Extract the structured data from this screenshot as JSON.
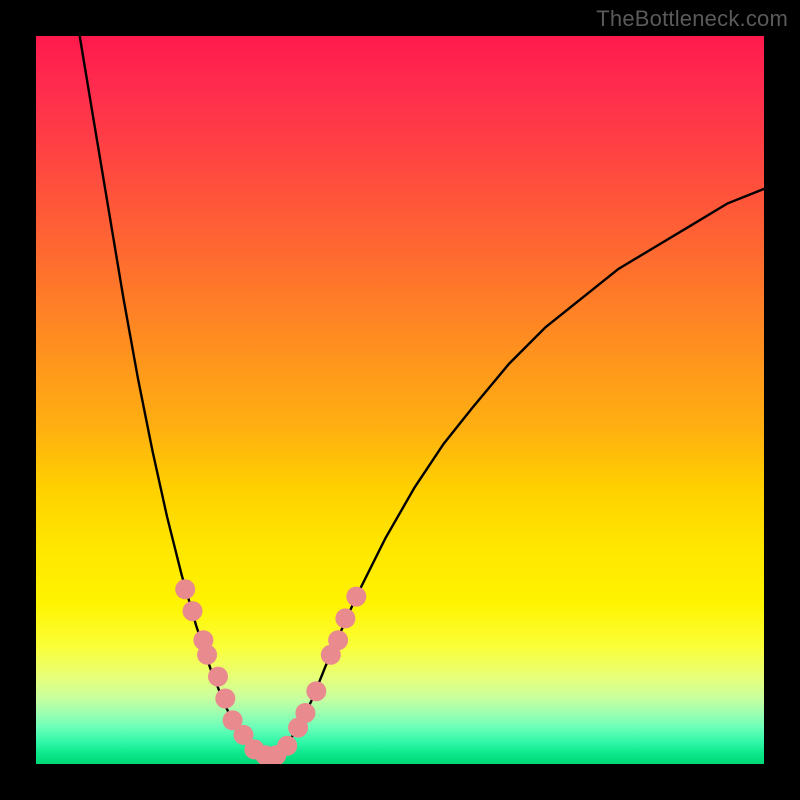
{
  "watermark": {
    "text": "TheBottleneck.com"
  },
  "colors": {
    "frame": "#000000",
    "curve": "#000000",
    "marker_fill": "#e98a8f",
    "marker_stroke": "#d06a70"
  },
  "chart_data": {
    "type": "line",
    "title": "",
    "xlabel": "",
    "ylabel": "",
    "xlim": [
      0,
      100
    ],
    "ylim": [
      0,
      100
    ],
    "curves": {
      "left": [
        {
          "x": 6,
          "y": 100
        },
        {
          "x": 8,
          "y": 88
        },
        {
          "x": 10,
          "y": 76
        },
        {
          "x": 12,
          "y": 64
        },
        {
          "x": 14,
          "y": 53
        },
        {
          "x": 16,
          "y": 43
        },
        {
          "x": 18,
          "y": 34
        },
        {
          "x": 20,
          "y": 26
        },
        {
          "x": 22,
          "y": 19
        },
        {
          "x": 24,
          "y": 13
        },
        {
          "x": 26,
          "y": 8
        },
        {
          "x": 28,
          "y": 4
        },
        {
          "x": 30,
          "y": 2
        },
        {
          "x": 32,
          "y": 1
        }
      ],
      "right": [
        {
          "x": 32,
          "y": 1
        },
        {
          "x": 34,
          "y": 2
        },
        {
          "x": 36,
          "y": 5
        },
        {
          "x": 38,
          "y": 9
        },
        {
          "x": 40,
          "y": 14
        },
        {
          "x": 44,
          "y": 23
        },
        {
          "x": 48,
          "y": 31
        },
        {
          "x": 52,
          "y": 38
        },
        {
          "x": 56,
          "y": 44
        },
        {
          "x": 60,
          "y": 49
        },
        {
          "x": 65,
          "y": 55
        },
        {
          "x": 70,
          "y": 60
        },
        {
          "x": 75,
          "y": 64
        },
        {
          "x": 80,
          "y": 68
        },
        {
          "x": 85,
          "y": 71
        },
        {
          "x": 90,
          "y": 74
        },
        {
          "x": 95,
          "y": 77
        },
        {
          "x": 100,
          "y": 79
        }
      ]
    },
    "markers": {
      "left": [
        {
          "x": 20.5,
          "y": 24
        },
        {
          "x": 21.5,
          "y": 21
        },
        {
          "x": 23.0,
          "y": 17
        },
        {
          "x": 23.5,
          "y": 15
        },
        {
          "x": 25.0,
          "y": 12
        },
        {
          "x": 26.0,
          "y": 9
        },
        {
          "x": 27.0,
          "y": 6
        },
        {
          "x": 28.5,
          "y": 4
        },
        {
          "x": 30.0,
          "y": 2
        },
        {
          "x": 31.5,
          "y": 1.2
        },
        {
          "x": 33.0,
          "y": 1.2
        }
      ],
      "right": [
        {
          "x": 34.5,
          "y": 2.5
        },
        {
          "x": 36.0,
          "y": 5
        },
        {
          "x": 37.0,
          "y": 7
        },
        {
          "x": 38.5,
          "y": 10
        },
        {
          "x": 40.5,
          "y": 15
        },
        {
          "x": 41.5,
          "y": 17
        },
        {
          "x": 42.5,
          "y": 20
        },
        {
          "x": 44.0,
          "y": 23
        }
      ]
    }
  }
}
